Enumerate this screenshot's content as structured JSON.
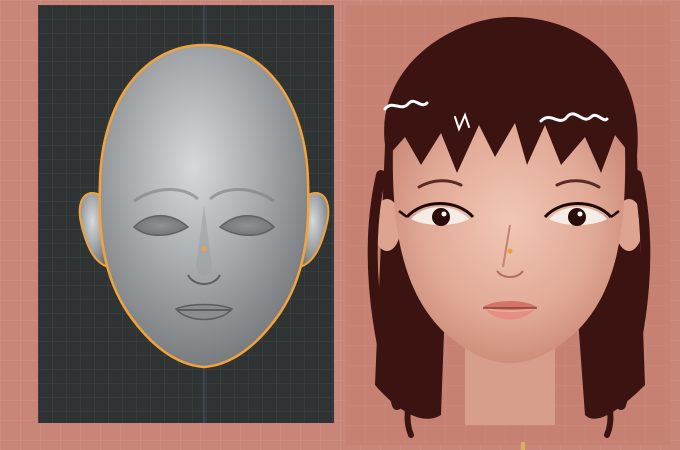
{
  "scene": {
    "left_view": {
      "kind": "3d-sculpt-viewport",
      "mesh_color": "#b9bcbd",
      "selection_outline_color": "#f2a33a",
      "background_color": "#2f3334"
    },
    "right_view": {
      "kind": "paint-overpaint-canvas",
      "skin_color": "#e6b4a2",
      "hair_color": "#3b1412",
      "background_color": "#c68173"
    },
    "page_background": "#c98578"
  }
}
